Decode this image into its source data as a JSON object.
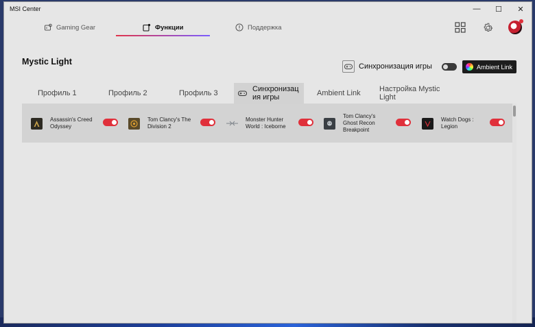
{
  "window": {
    "title": "MSI Center",
    "controls": {
      "minimize": "—",
      "maximize": "☐",
      "close": "✕"
    }
  },
  "topnav": {
    "tabs": [
      {
        "label": "Gaming Gear",
        "icon": "gamepad-gear-icon",
        "active": false
      },
      {
        "label": "Функции",
        "icon": "features-icon",
        "active": true
      },
      {
        "label": "Поддержка",
        "icon": "support-icon",
        "active": false
      }
    ],
    "right_icons": [
      "grid-icon",
      "gear-icon",
      "avatar"
    ]
  },
  "section": {
    "title": "Mystic Light",
    "sync_label": "Синхронизация игры",
    "sync_enabled": false,
    "ambient_button": "Ambient Link"
  },
  "tabs": [
    {
      "label": "Профиль 1",
      "active": false
    },
    {
      "label": "Профиль 2",
      "active": false
    },
    {
      "label": "Профиль 3",
      "active": false
    },
    {
      "label": "Синхронизац ия игры",
      "active": true,
      "icon": "gamepad-icon"
    },
    {
      "label": "Ambient Link",
      "active": false
    },
    {
      "label": "Настройка Mystic Light",
      "active": false
    }
  ],
  "games": [
    {
      "name": "Assassin's Creed Odyssey",
      "enabled": true,
      "icon_color": "#2d2a22"
    },
    {
      "name": "Tom Clancy's The Division 2",
      "enabled": true,
      "icon_color": "#5a4a2a"
    },
    {
      "name": "Monster Hunter World : Iceborne",
      "enabled": true,
      "icon_color": "#9aa0a6"
    },
    {
      "name": "Tom Clancy's Ghost Recon Breakpoint",
      "enabled": true,
      "icon_color": "#3a3f44"
    },
    {
      "name": "Watch Dogs : Legion",
      "enabled": true,
      "icon_color": "#1a1a1a"
    }
  ],
  "colors": {
    "accent_red": "#e0303b",
    "window_bg": "#e6e6e6",
    "panel_bg": "#d3d3d3"
  }
}
